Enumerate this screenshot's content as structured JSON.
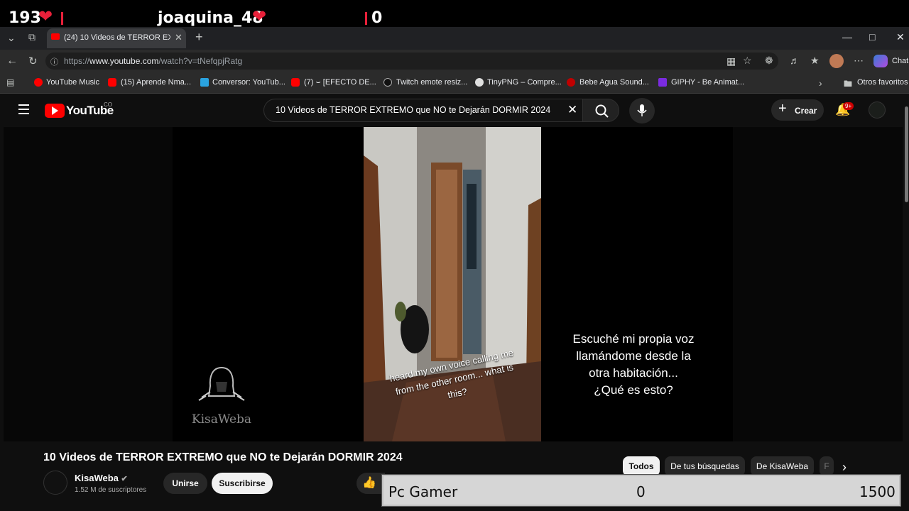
{
  "overlay": {
    "likes_count": "193",
    "username": "joaquina_48",
    "right_count": "0",
    "heart_color": "#e8203a"
  },
  "browser": {
    "active_tab_title": "(24) 10 Videos de TERROR EXTREMO",
    "url_prefix": "https://",
    "url_host": "www.youtube.com",
    "url_path": "/watch?v=tNefqpjRatg",
    "chat_label": "Chat",
    "bookmarks": [
      "YouTube Music",
      "(15) Aprende Nma...",
      "Conversor: YouTub...",
      "(7) ⌣ [EFECTO DE...",
      "Twitch emote resiz...",
      "TinyPNG – Compre...",
      "Bebe Agua Sound...",
      "GIPHY - Be Animat..."
    ],
    "other_bookmarks": "Otros favoritos"
  },
  "youtube": {
    "logo_text": "YouTube",
    "country_code": "CO",
    "search_value": "10 Videos de TERROR EXTREMO que NO te Dejarán DORMIR 2024",
    "create_label": "Crear",
    "notif_badge": "9+",
    "brand_color": "#ff0000"
  },
  "video": {
    "overlay_text_en": "heard my own voice calling me from the other room... what is this?",
    "subtitle_es_lines": [
      "Escuché mi propia voz",
      "llamándome desde la",
      "otra habitación...",
      "¿Qué es esto?"
    ],
    "watermark": "KisaWeba",
    "title": "10 Videos de TERROR EXTREMO que NO te Dejarán DORMIR 2024"
  },
  "channel": {
    "name": "KisaWeba",
    "subscribers": "1.52 M de suscriptores",
    "join_label": "Unirse",
    "subscribe_label": "Suscribirse"
  },
  "chips": [
    "Todos",
    "De tus búsquedas",
    "De KisaWeba",
    "F"
  ],
  "pc_gamer": {
    "label": "Pc Gamer",
    "current": "0",
    "goal": "1500"
  }
}
